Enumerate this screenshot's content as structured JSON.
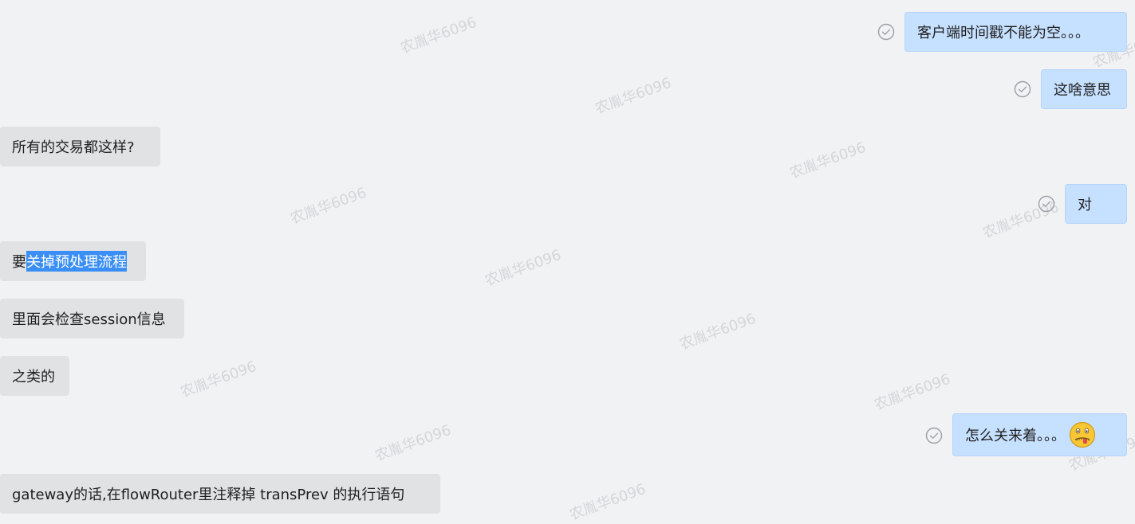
{
  "watermark": "农胤华6096",
  "messages": [
    {
      "side": "right",
      "text": "客户端时间戳不能为空。。。"
    },
    {
      "side": "right",
      "text": "这啥意思"
    },
    {
      "side": "left",
      "text": "所有的交易都这样?"
    },
    {
      "side": "right",
      "text": "对"
    },
    {
      "side": "left",
      "text_prefix": "要",
      "text_selected": "关掉预处理流程"
    },
    {
      "side": "left",
      "text": "里面会检查session信息"
    },
    {
      "side": "left",
      "text": "之类的"
    },
    {
      "side": "right",
      "text": "怎么关来着。。。",
      "emoji": "zipper-mouth-face-icon"
    },
    {
      "side": "left",
      "text": "gateway的话,在flowRouter里注释掉 transPrev 的执行语句"
    }
  ],
  "colors": {
    "background": "#f1f2f4",
    "incoming_bubble": "#e1e2e4",
    "outgoing_bubble": "#c6e0ff",
    "selection": "#3a8ef6",
    "read_check": "#9aa0a6"
  },
  "icons": {
    "read_receipt": "check-circle-icon",
    "emoji": "zipper-mouth-face-icon"
  }
}
